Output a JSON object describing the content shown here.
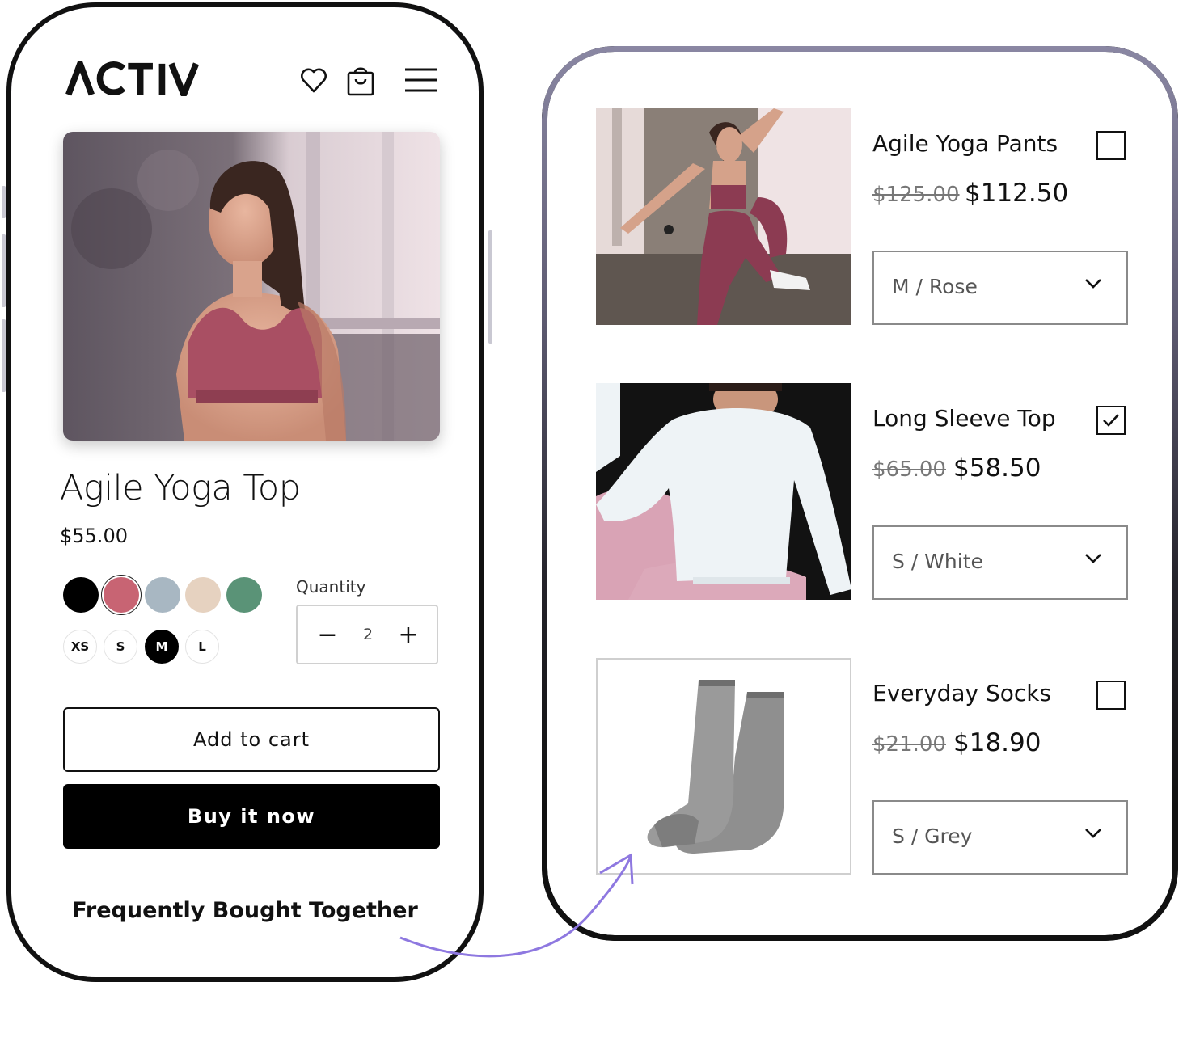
{
  "brand": {
    "logo": "ACTIV",
    "accent": "#000000"
  },
  "header": {
    "icons": [
      "heart-icon",
      "bag-icon",
      "menu-icon"
    ]
  },
  "product": {
    "title": "Agile Yoga Top",
    "price": "$55.00",
    "colors": [
      {
        "name": "black",
        "hex": "#000000"
      },
      {
        "name": "rose",
        "hex": "#c86473"
      },
      {
        "name": "grey-blue",
        "hex": "#a8b7c2"
      },
      {
        "name": "beige",
        "hex": "#e6d2c0"
      },
      {
        "name": "green",
        "hex": "#5a9377"
      }
    ],
    "selected_color": "rose",
    "sizes": [
      "XS",
      "S",
      "M",
      "L"
    ],
    "selected_size": "M",
    "quantity_label": "Quantity",
    "quantity": "2",
    "minus": "−",
    "plus": "+",
    "add_to_cart": "Add to cart",
    "buy_now": "Buy it now"
  },
  "fbt": {
    "heading": "Frequently Bought Together",
    "items": [
      {
        "name": "Agile Yoga Pants",
        "old_price": "$125.00",
        "price": "$112.50",
        "variant": "M / Rose",
        "checked": false
      },
      {
        "name": "Long Sleeve Top",
        "old_price": "$65.00",
        "price": "$58.50",
        "variant": "S / White",
        "checked": true
      },
      {
        "name": "Everyday Socks",
        "old_price": "$21.00",
        "price": "$18.90",
        "variant": "S / Grey",
        "checked": false
      }
    ],
    "arrow_color": "#8e78e0"
  }
}
